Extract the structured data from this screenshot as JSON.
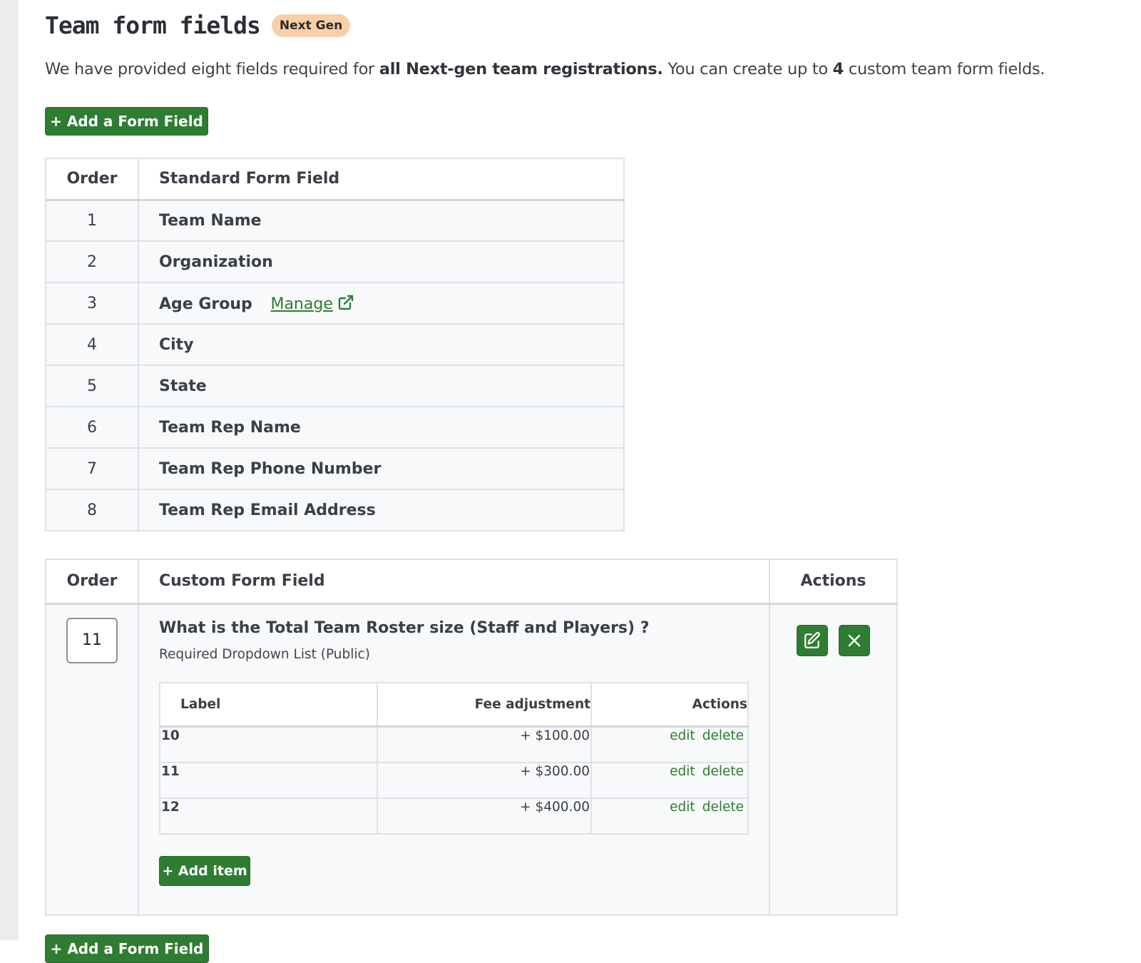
{
  "header": {
    "title": "Team form fields",
    "badge": "Next Gen"
  },
  "intro": {
    "part1": "We have provided eight fields required for ",
    "bold1": "all Next-gen team registrations.",
    "part2": " You can create up to ",
    "bold2": "4",
    "part3": " custom team form fields."
  },
  "buttons": {
    "add_form_field": "+ Add a Form Field",
    "add_item": "+ Add item"
  },
  "standard_table": {
    "col_order": "Order",
    "col_field": "Standard Form Field",
    "manage_label": "Manage",
    "rows": [
      {
        "order": "1",
        "field": "Team Name"
      },
      {
        "order": "2",
        "field": "Organization"
      },
      {
        "order": "3",
        "field": "Age Group"
      },
      {
        "order": "4",
        "field": "City"
      },
      {
        "order": "5",
        "field": "State"
      },
      {
        "order": "6",
        "field": "Team Rep Name"
      },
      {
        "order": "7",
        "field": "Team Rep Phone Number"
      },
      {
        "order": "8",
        "field": "Team Rep Email Address"
      }
    ]
  },
  "custom_table": {
    "col_order": "Order",
    "col_field": "Custom Form Field",
    "col_actions": "Actions",
    "field": {
      "order_value": "11",
      "question": "What is the Total Team Roster size (Staff and Players) ?",
      "subtitle": "Required Dropdown List (Public)",
      "options_headers": {
        "label": "Label",
        "fee": "Fee adjustment",
        "actions": "Actions"
      },
      "options": [
        {
          "label": "10",
          "fee": "+ $100.00",
          "edit": "edit",
          "delete": "delete"
        },
        {
          "label": "11",
          "fee": "+ $300.00",
          "edit": "edit",
          "delete": "delete"
        },
        {
          "label": "12",
          "fee": "+ $400.00",
          "edit": "edit",
          "delete": "delete"
        }
      ]
    }
  },
  "icons": {
    "edit": "edit-icon",
    "close": "close-icon",
    "external": "external-link-icon"
  },
  "colors": {
    "accent_green": "#2e7d32",
    "badge_bg": "#f9cfa8"
  }
}
